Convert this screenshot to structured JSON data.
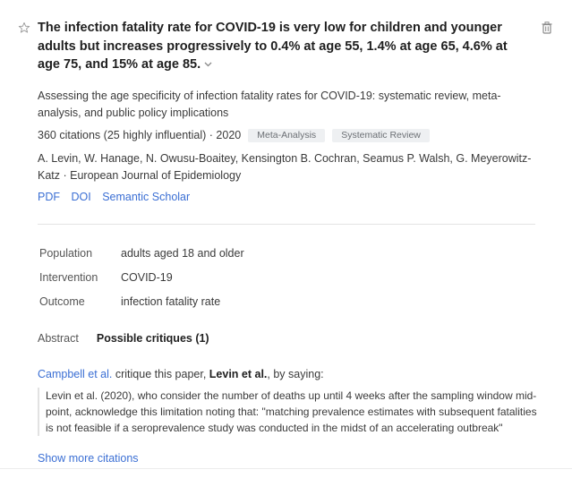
{
  "claim": {
    "text": "The infection fatality rate for COVID-19 is very low for children and younger adults but increases progressively to 0.4% at age 55, 1.4% at age 65, 4.6% at age 75, and 15% at age 85.",
    "expand_icon": "chevron-down-icon",
    "star_icon": "star-icon",
    "delete_icon": "trash-icon"
  },
  "paper": {
    "title": "Assessing the age specificity of infection fatality rates for COVID-19: systematic review, meta-analysis, and public policy implications",
    "citations": "360 citations (25 highly influential)",
    "separator": " · ",
    "year": "2020",
    "tags": [
      "Meta-Analysis",
      "Systematic Review"
    ],
    "authors": "A. Levin, W. Hanage, N. Owusu-Boaitey, Kensington B. Cochran, Seamus P. Walsh, G. Meyerowitz-Katz",
    "venue": "European Journal of Epidemiology",
    "links": [
      "PDF",
      "DOI",
      "Semantic Scholar"
    ]
  },
  "pico": [
    {
      "key": "Population",
      "value": "adults aged 18 and older"
    },
    {
      "key": "Intervention",
      "value": "COVID-19"
    },
    {
      "key": "Outcome",
      "value": "infection fatality rate"
    }
  ],
  "tabs": {
    "abstract": "Abstract",
    "critiques": "Possible critiques (1)"
  },
  "critique": {
    "author_link": "Campbell et al.",
    "middle": " critique this paper, ",
    "target": "Levin et al.",
    "end": ", by saying:",
    "quote": "Levin et al. (2020), who consider the number of deaths up until 4 weeks after the sampling window mid-point, acknowledge this limitation noting that: \"matching prevalence estimates with subsequent fatalities is not feasible if a seroprevalence study was conducted in the midst of an accelerating outbreak\""
  },
  "show_more": "Show more citations",
  "colors": {
    "link": "#3b6fd4",
    "tag_bg": "#eef0f2"
  }
}
